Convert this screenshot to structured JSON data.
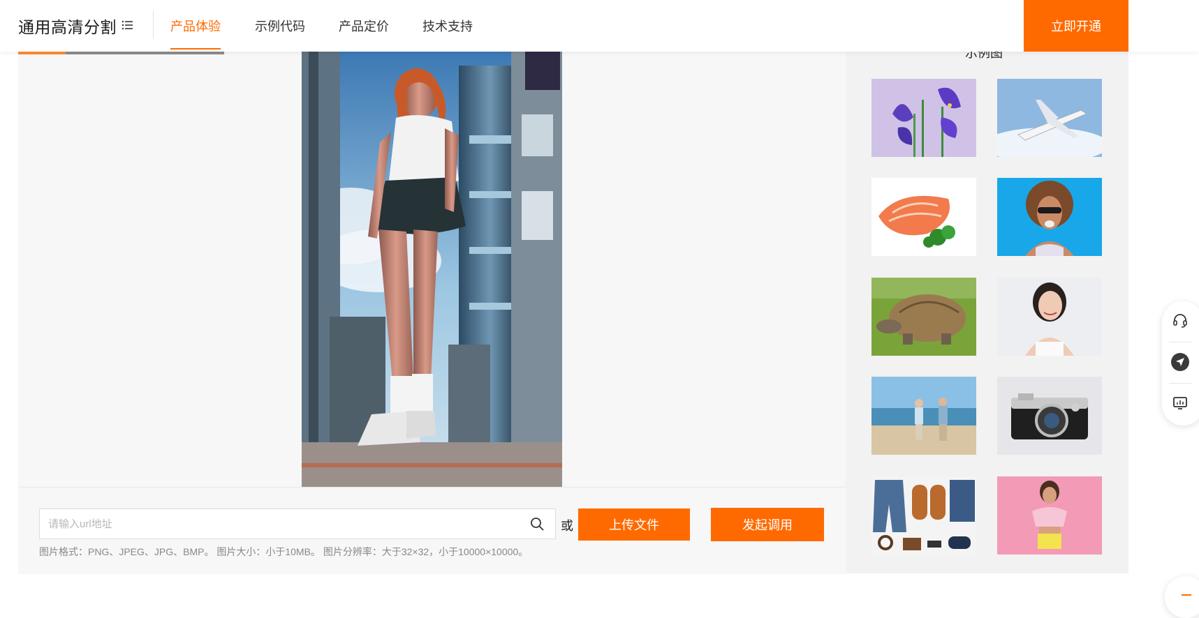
{
  "header": {
    "brand_title": "通用高清分割",
    "nav": [
      {
        "label": "产品体验",
        "active": true
      },
      {
        "label": "示例代码",
        "active": false
      },
      {
        "label": "产品定价",
        "active": false
      },
      {
        "label": "技术支持",
        "active": false
      }
    ],
    "cta_label": "立即开通"
  },
  "main": {
    "progress_fraction": 0.23,
    "input": {
      "placeholder": "请输入url地址",
      "value": ""
    },
    "or_text": "或",
    "upload_label": "上传文件",
    "submit_label": "发起调用",
    "hint": "图片格式：PNG、JPEG、JPG、BMP。 图片大小：小于10MB。 图片分辨率：大于32×32，小于10000×10000。"
  },
  "examples": {
    "title": "示例图",
    "items": [
      {
        "subject": "iris-flowers"
      },
      {
        "subject": "airplane"
      },
      {
        "subject": "salmon-steak"
      },
      {
        "subject": "woman-sunglasses"
      },
      {
        "subject": "tortoise"
      },
      {
        "subject": "woman-portrait"
      },
      {
        "subject": "couple-beach"
      },
      {
        "subject": "camera"
      },
      {
        "subject": "clothes-flatlay"
      },
      {
        "subject": "woman-pink-background"
      }
    ]
  },
  "side_tools": [
    "headset-icon",
    "send-icon",
    "monitor-chart-icon"
  ],
  "colors": {
    "accent": "#ff6a00",
    "panel": "#f7f7f7",
    "sidebar": "#f2f2f2"
  }
}
